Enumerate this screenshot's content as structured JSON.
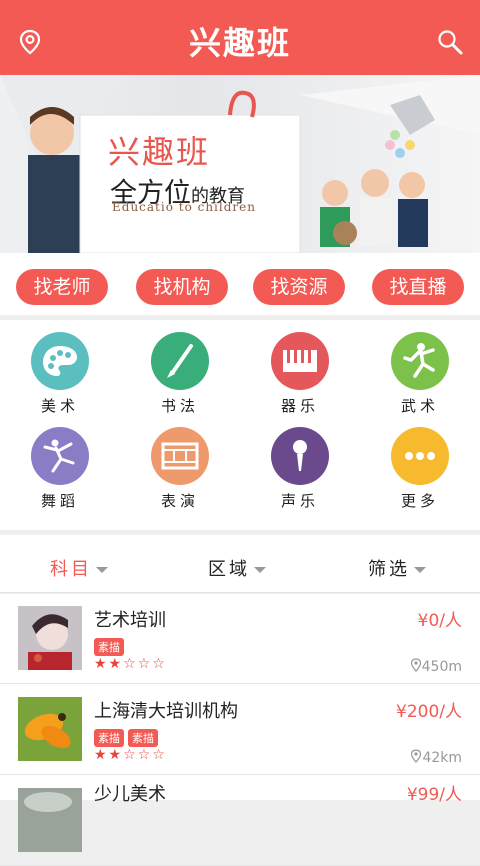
{
  "header": {
    "title": "兴趣班",
    "left_icon": "location-pin-icon",
    "right_icon": "search-icon"
  },
  "banner": {
    "title": "兴趣班",
    "subtitle_big": "全方位",
    "subtitle_small": "的教育",
    "english": "Educatio to children"
  },
  "quick_links": [
    {
      "label": "找老师"
    },
    {
      "label": "找机构"
    },
    {
      "label": "找资源"
    },
    {
      "label": "找直播"
    }
  ],
  "categories": [
    {
      "label": "美术",
      "icon": "palette-icon",
      "color": "#5bbfc0"
    },
    {
      "label": "书法",
      "icon": "brush-icon",
      "color": "#3aae7a"
    },
    {
      "label": "器乐",
      "icon": "piano-icon",
      "color": "#e4575a"
    },
    {
      "label": "武术",
      "icon": "martial-arts-icon",
      "color": "#7cc24a"
    },
    {
      "label": "舞蹈",
      "icon": "dancer-icon",
      "color": "#8b7cc6"
    },
    {
      "label": "表演",
      "icon": "film-strip-icon",
      "color": "#ef9a6c"
    },
    {
      "label": "声乐",
      "icon": "microphone-icon",
      "color": "#6a4a8c"
    },
    {
      "label": "更多",
      "icon": "more-dots-icon",
      "color": "#f7b92d"
    }
  ],
  "filters": [
    {
      "label": "科目",
      "active": true
    },
    {
      "label": "区域",
      "active": false
    },
    {
      "label": "筛选",
      "active": false
    }
  ],
  "listings": [
    {
      "name": "艺术培训",
      "price": "¥0/人",
      "tags": [
        "素描"
      ],
      "rating": 2,
      "stars": "★★☆☆☆",
      "distance": "450m"
    },
    {
      "name": "上海清大培训机构",
      "price": "¥200/人",
      "tags": [
        "素描",
        "素描"
      ],
      "rating": 2,
      "stars": "★★☆☆☆",
      "distance": "42km"
    },
    {
      "name": "少儿美术",
      "price": "¥99/人",
      "tags": [],
      "rating": null,
      "stars": "",
      "distance": ""
    }
  ],
  "colors": {
    "brand": "#f25a53"
  }
}
